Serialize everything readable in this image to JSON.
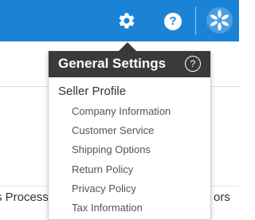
{
  "header": {
    "help_label": "?",
    "accent_color": "#1a83d6"
  },
  "background": {
    "left_text": "s Processi",
    "right_text": "ors"
  },
  "dropdown": {
    "title": "General Settings",
    "help_label": "?",
    "section": "Seller Profile",
    "items": [
      {
        "label": "Company Information"
      },
      {
        "label": "Customer Service"
      },
      {
        "label": "Shipping Options"
      },
      {
        "label": "Return Policy"
      },
      {
        "label": "Privacy Policy"
      },
      {
        "label": "Tax Information"
      }
    ]
  }
}
